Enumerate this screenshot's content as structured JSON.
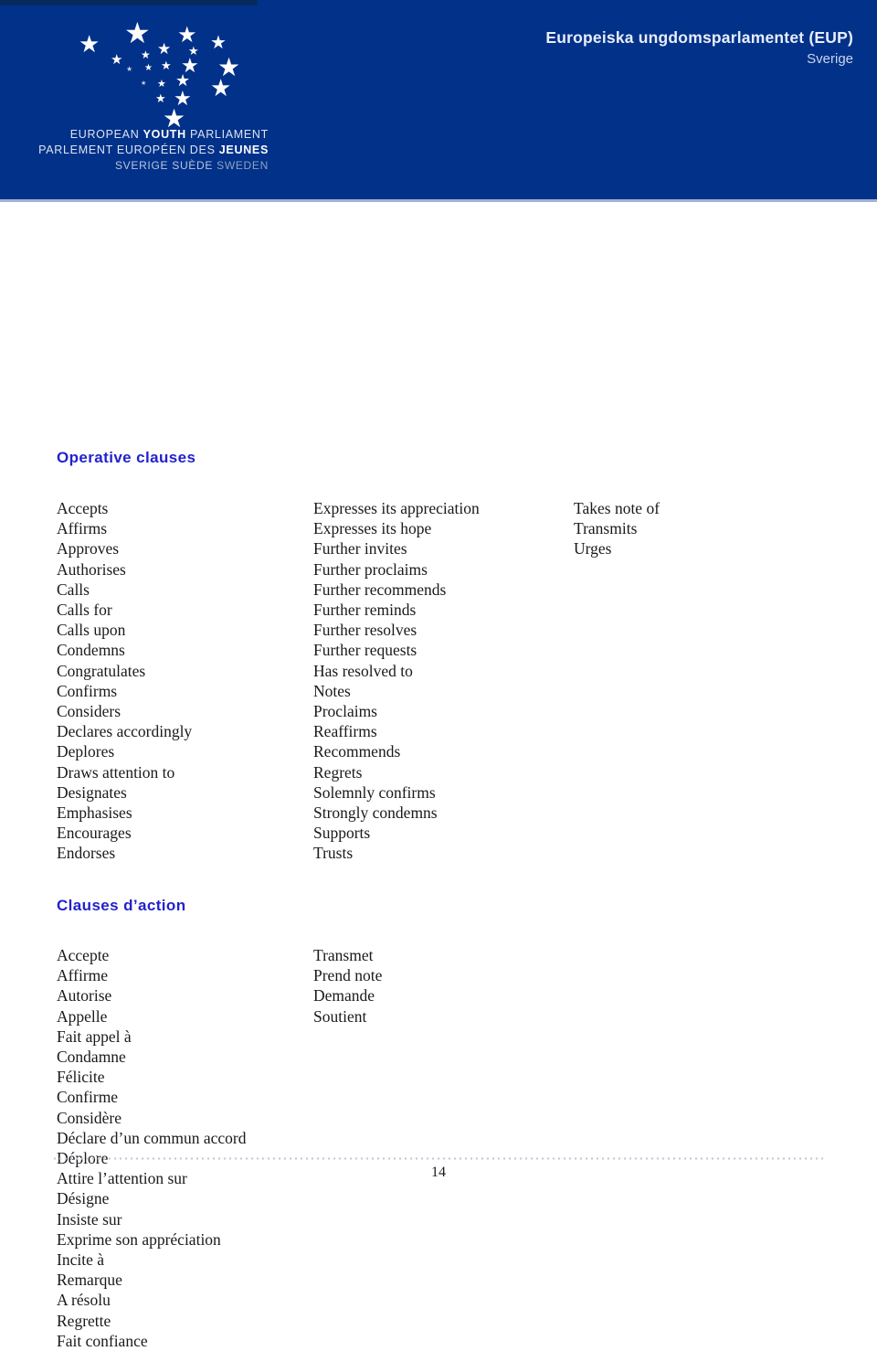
{
  "header": {
    "title_main": "Europeiska ungdomsparlamentet (EUP)",
    "title_sub": "Sverige",
    "logo": {
      "line1_a": "EUROPEAN ",
      "line1_b": "YOUTH",
      "line1_c": " PARLIAMENT",
      "line2_a": "PARLEMENT EUROPÉEN DES ",
      "line2_b": "JEUNES",
      "line3_a": "SVERIGE SUÈDE",
      "line3_b": " SWEDEN"
    }
  },
  "sections": [
    {
      "heading": "Operative clauses",
      "columns": [
        [
          "Accepts",
          "Affirms",
          "Approves",
          "Authorises",
          "Calls",
          "Calls for",
          "Calls upon",
          "Condemns",
          "Congratulates",
          "Confirms",
          "Considers",
          "Declares accordingly",
          "Deplores",
          "Draws attention to",
          "Designates",
          "Emphasises",
          "Encourages",
          "Endorses"
        ],
        [
          "Expresses its appreciation",
          "Expresses its hope",
          "Further invites",
          "Further proclaims",
          "Further recommends",
          "Further reminds",
          "Further resolves",
          "Further requests",
          "Has resolved to",
          "Notes",
          "Proclaims",
          "Reaffirms",
          "Recommends",
          "Regrets",
          "Solemnly confirms",
          "Strongly condemns",
          "Supports",
          "Trusts"
        ],
        [
          "Takes note of",
          "Transmits",
          "Urges"
        ]
      ]
    },
    {
      "heading": "Clauses d’action",
      "columns": [
        [
          "Accepte",
          "Affirme",
          "Autorise",
          "Appelle",
          "Fait appel à",
          "Condamne",
          "Félicite",
          "Confirme",
          "Considère",
          "Déclare d’un commun accord",
          "Déplore",
          "Attire l’attention sur",
          "Désigne",
          "Insiste sur",
          "Exprime son appréciation",
          "Incite à",
          "Remarque",
          "A résolu",
          "Regrette",
          "Fait confiance"
        ],
        [
          "Transmet",
          "Prend note",
          "Demande",
          "Soutient"
        ]
      ]
    }
  ],
  "footer": {
    "page_number": "14"
  },
  "colors": {
    "header_background": "#013189",
    "heading_accent": "#2222cc",
    "body_text": "#1a1a1a",
    "footer_dots": "#c9cbdd"
  }
}
